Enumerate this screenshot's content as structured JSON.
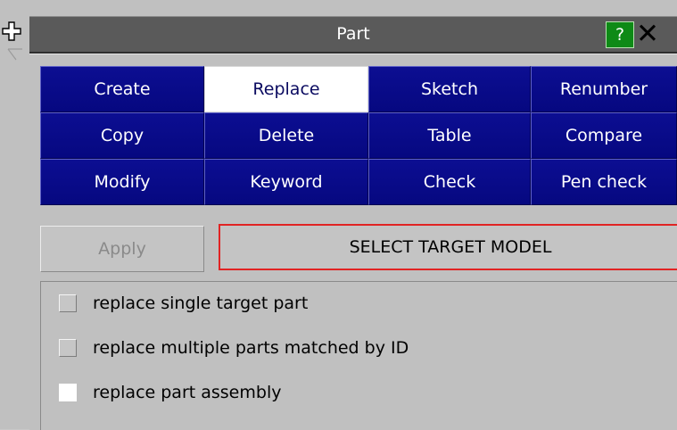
{
  "window": {
    "title": "Part",
    "help_label": "?",
    "close_label": "✕"
  },
  "tabs": [
    {
      "label": "Create",
      "active": false
    },
    {
      "label": "Replace",
      "active": true
    },
    {
      "label": "Sketch",
      "active": false
    },
    {
      "label": "Renumber",
      "active": false
    },
    {
      "label": "Copy",
      "active": false
    },
    {
      "label": "Delete",
      "active": false
    },
    {
      "label": "Table",
      "active": false
    },
    {
      "label": "Compare",
      "active": false
    },
    {
      "label": "Modify",
      "active": false
    },
    {
      "label": "Keyword",
      "active": false
    },
    {
      "label": "Check",
      "active": false
    },
    {
      "label": "Pen check",
      "active": false
    }
  ],
  "actions": {
    "apply_label": "Apply",
    "select_target_label": "SELECT TARGET MODEL"
  },
  "options": [
    {
      "label": "replace single target part",
      "checked": false
    },
    {
      "label": "replace multiple parts matched by ID",
      "checked": false
    },
    {
      "label": "replace part assembly",
      "checked": true
    }
  ],
  "colors": {
    "tab_blue": "#0a0c8c",
    "active_tab": "#ffffff",
    "title_bar": "#5a5a5a",
    "help_green": "#0e8a16",
    "select_border": "#e12424",
    "panel_bg": "#c0c0c0"
  },
  "icons": {
    "move_handle": "move-arrows-icon",
    "help": "help-icon",
    "close": "close-icon"
  }
}
